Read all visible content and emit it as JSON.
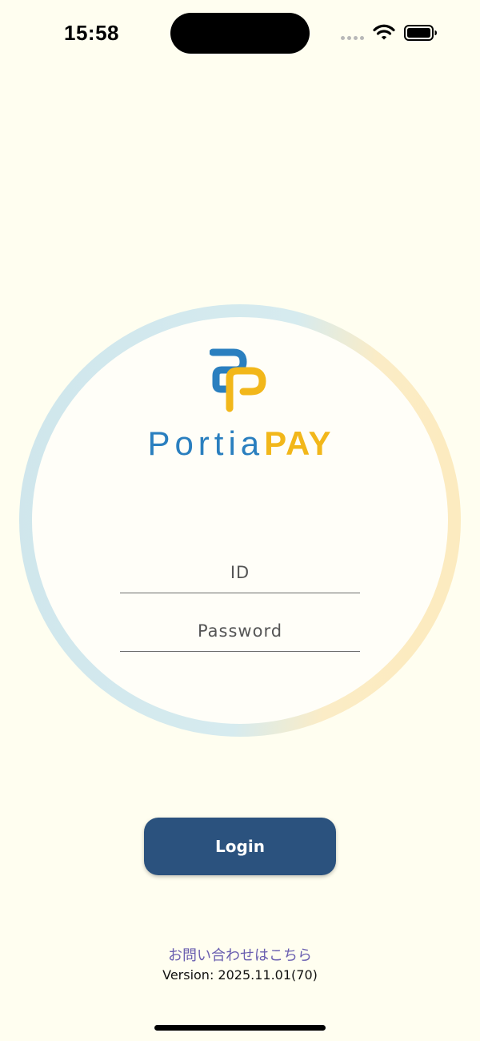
{
  "status_bar": {
    "time": "15:58",
    "icons": [
      "cellular-dots-icon",
      "wifi-icon",
      "battery-icon"
    ]
  },
  "brand": {
    "name_part1": "Portia",
    "name_part2": "PAY",
    "logo_icon": "portia-pp-logo-icon",
    "colors": {
      "blue": "#2a7fbf",
      "yellow": "#f2b71a"
    }
  },
  "login_form": {
    "id_placeholder": "ID",
    "id_value": "",
    "password_placeholder": "Password",
    "password_value": "",
    "login_label": "Login",
    "button_color": "#2b527e"
  },
  "footer": {
    "contact_link": "お問い合わせはこちら",
    "version": "Version: 2025.11.01(70)"
  },
  "theme": {
    "background": "#fffef0",
    "ring_blue": "#cfe6ec",
    "ring_yellow": "#fcebc0"
  }
}
